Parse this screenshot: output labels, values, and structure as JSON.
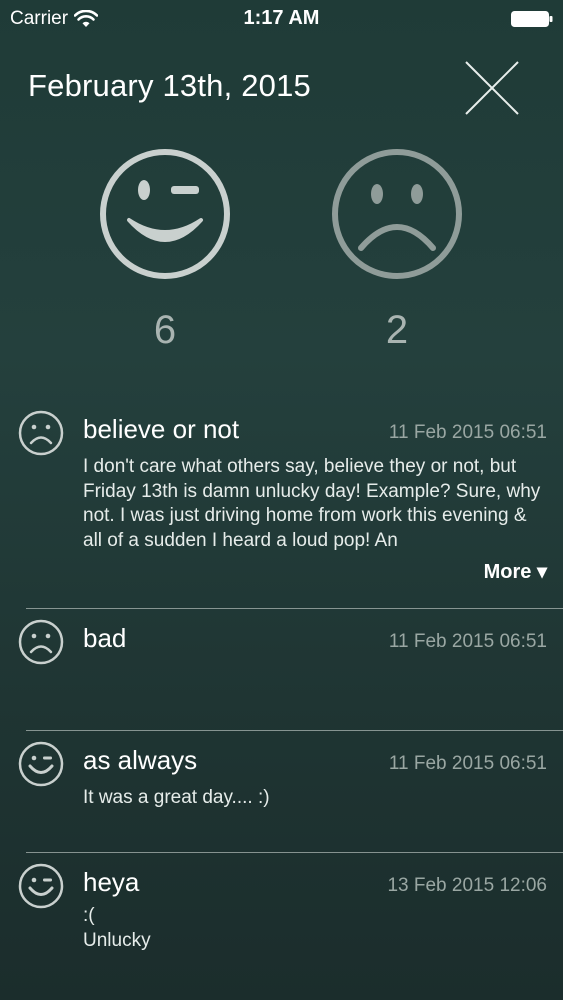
{
  "status_bar": {
    "carrier": "Carrier",
    "time": "1:17 AM",
    "wifi_icon": "wifi-icon",
    "battery_icon": "battery-icon"
  },
  "header": {
    "date": "February 13th, 2015",
    "close_icon": "close-icon"
  },
  "summary": {
    "happy_icon": "winking-smiley-icon",
    "happy_count": "6",
    "sad_icon": "sad-face-icon",
    "sad_count": "2"
  },
  "entries": [
    {
      "mood": "sad",
      "title": "believe or not",
      "time": "11 Feb 2015 06:51",
      "body": "I don't care what others say, believe they or not, but Friday 13th is damn unlucky day! Example? Sure, why not. I was just driving home from work this evening & all of a sudden I heard a loud pop! An",
      "more_label": "More ▾"
    },
    {
      "mood": "sad",
      "title": "bad",
      "time": "11 Feb 2015 06:51",
      "body": ""
    },
    {
      "mood": "happy",
      "title": "as always",
      "time": "11 Feb 2015 06:51",
      "body": "It was a great day.... :)"
    },
    {
      "mood": "happy",
      "title": "heya",
      "time": "13 Feb 2015 12:06",
      "body": ":(\nUnlucky"
    }
  ],
  "colors": {
    "background_top": "#1f3b37",
    "background_bottom": "#1b2d2c",
    "face_stroke": "#c9d0ce",
    "muted_text": "#9aa7a3"
  }
}
